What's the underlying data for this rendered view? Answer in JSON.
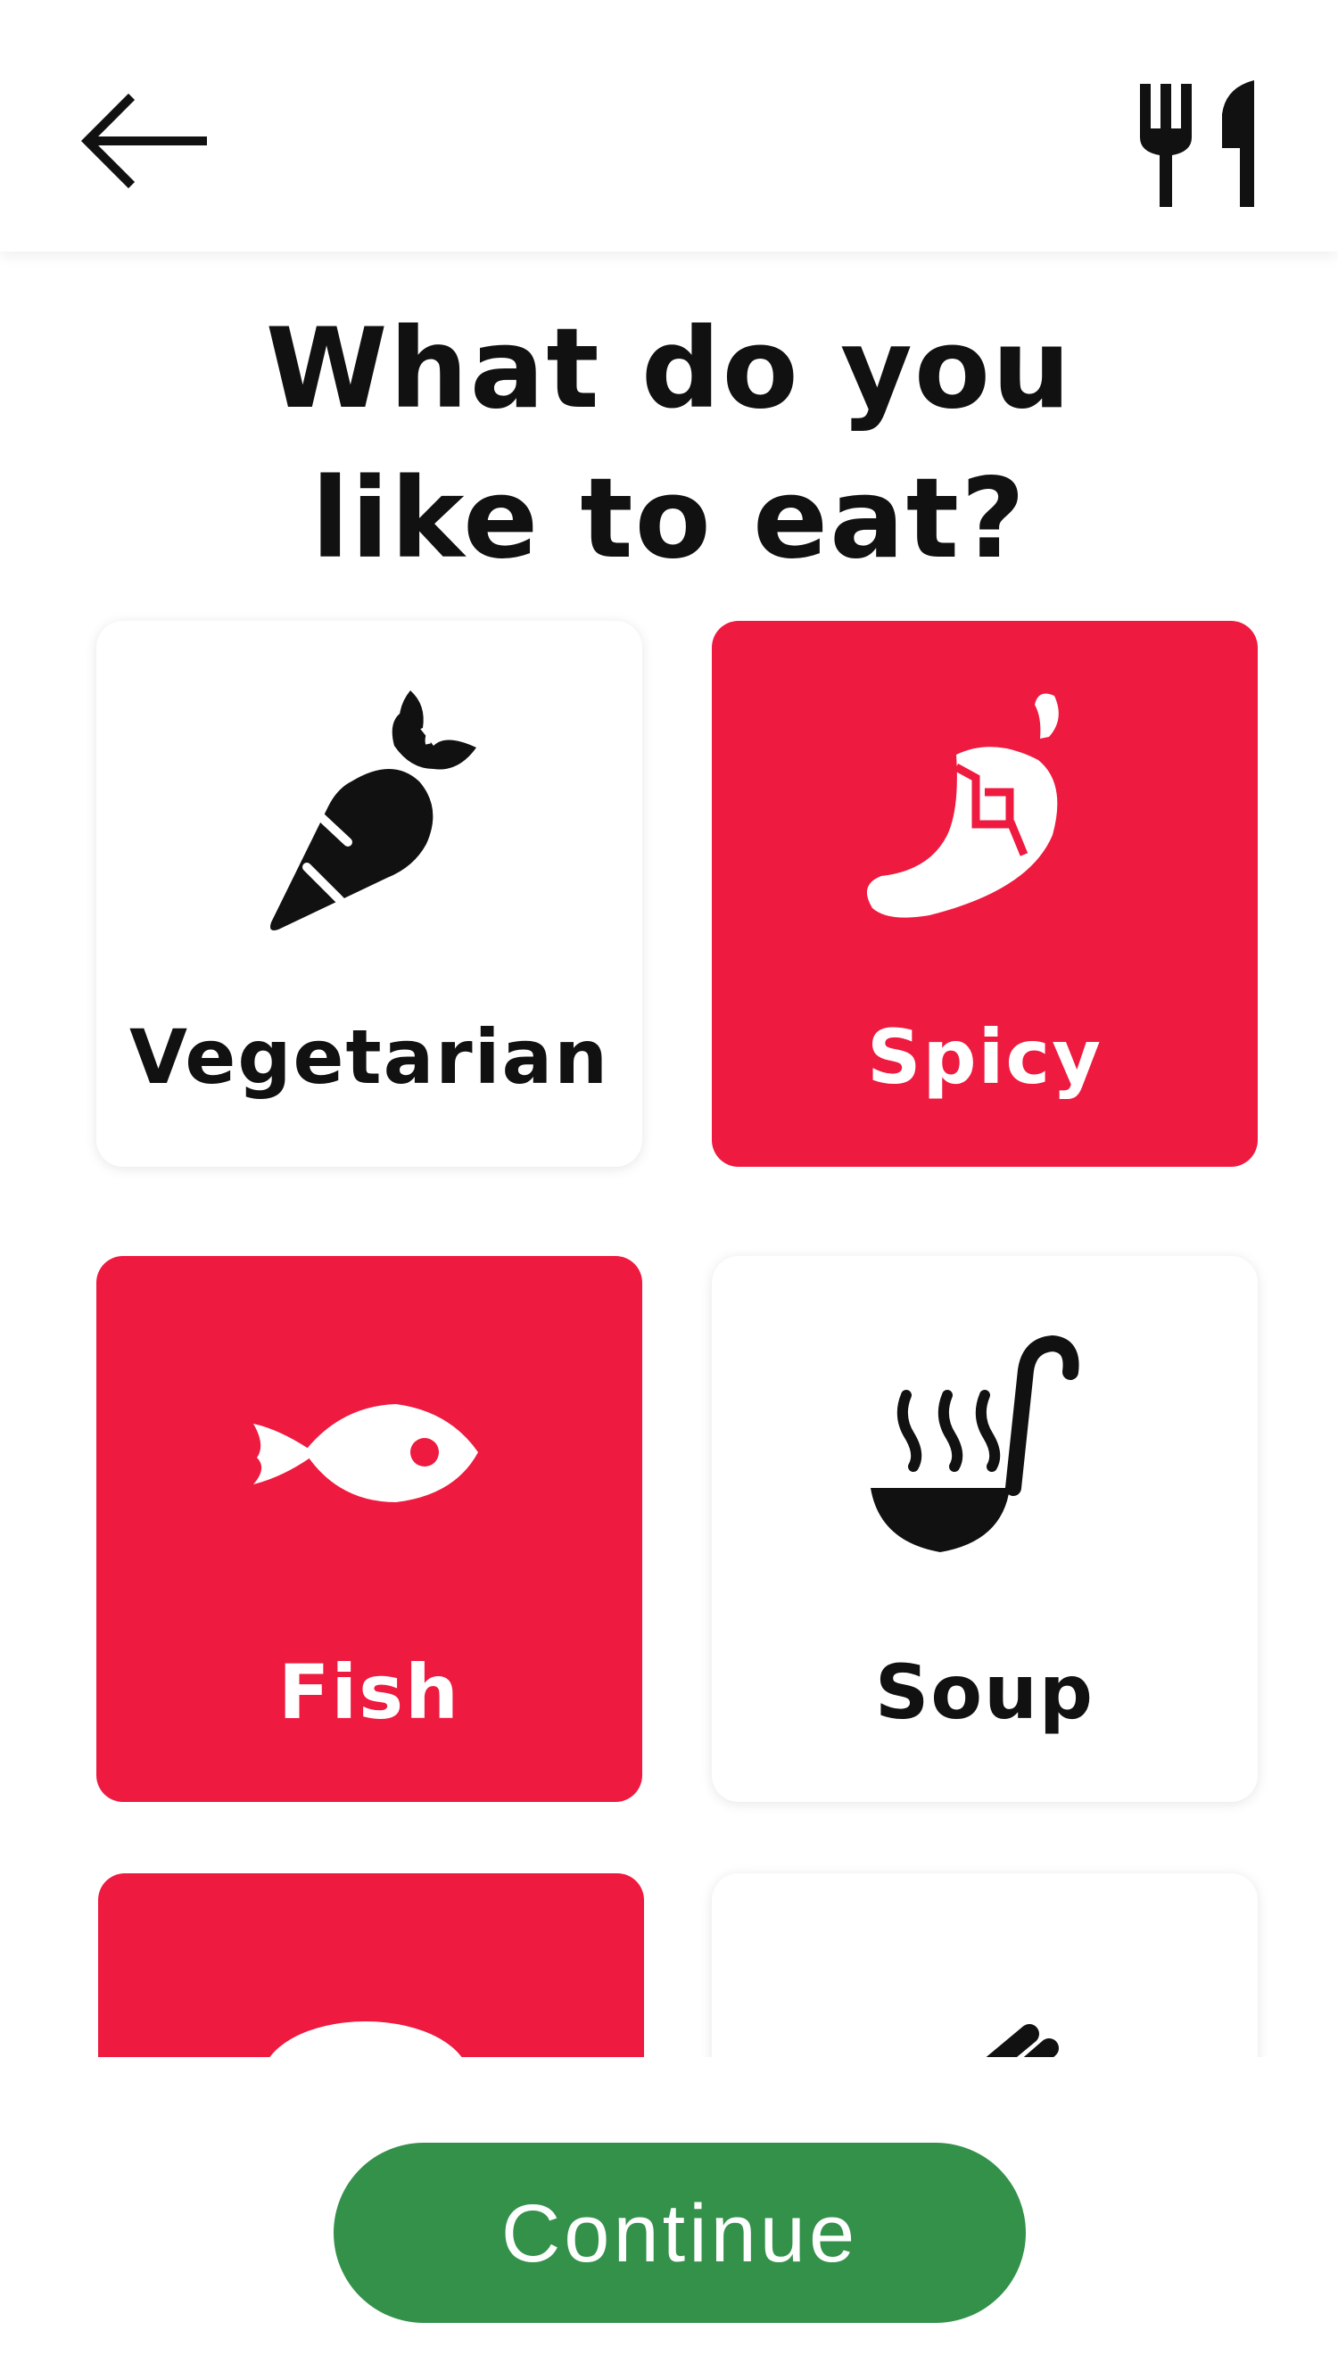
{
  "header": {
    "back_icon": "arrow-left-icon",
    "brand_icon": "fork-knife-icon"
  },
  "title": "What do you like to eat?",
  "options": [
    {
      "label": "Vegetarian",
      "icon": "carrot-icon",
      "selected": false
    },
    {
      "label": "Spicy",
      "icon": "chili-pepper-icon",
      "selected": true
    },
    {
      "label": "Fish",
      "icon": "fish-icon",
      "selected": true
    },
    {
      "label": "Soup",
      "icon": "soup-ladle-icon",
      "selected": false
    },
    {
      "label": "",
      "icon": "egg-icon",
      "selected": true
    },
    {
      "label": "",
      "icon": "hand-icon",
      "selected": false
    }
  ],
  "continue_label": "Continue",
  "colors": {
    "accent_red": "#ee1a3f",
    "button_green": "#33914a",
    "text": "#111111",
    "background": "#ffffff"
  }
}
